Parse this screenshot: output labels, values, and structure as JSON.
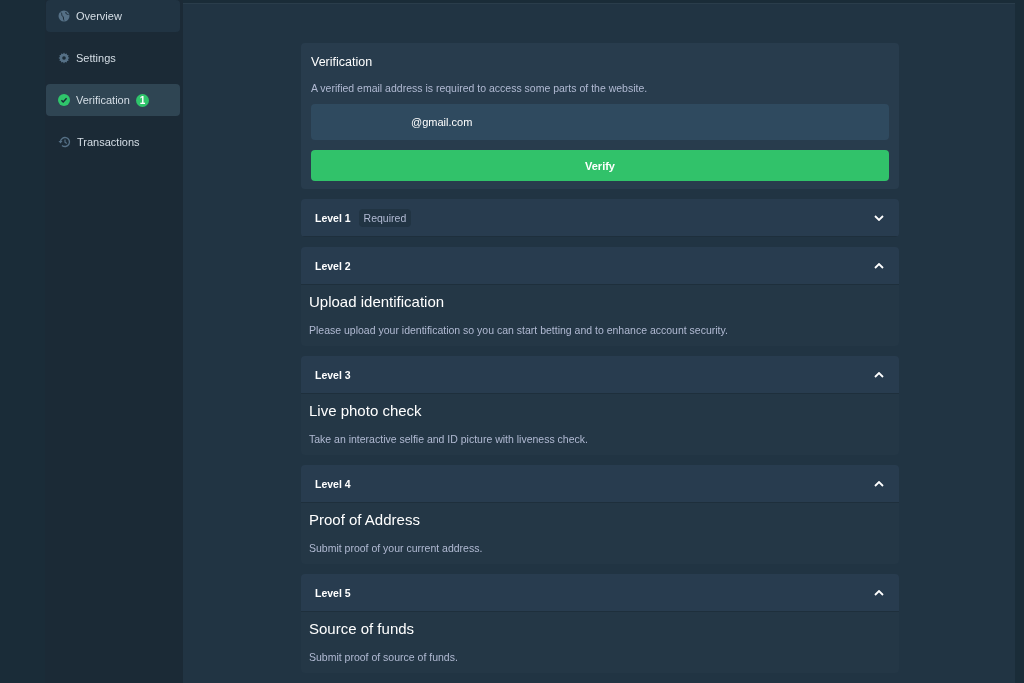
{
  "sidebar": {
    "items": [
      {
        "label": "Overview",
        "kind": "globe",
        "selected": false,
        "hovered": true
      },
      {
        "label": "Settings",
        "kind": "gear",
        "selected": false,
        "hovered": false
      },
      {
        "label": "Verification",
        "kind": "check",
        "selected": true,
        "hovered": false,
        "badge": "1"
      },
      {
        "label": "Transactions",
        "kind": "history",
        "selected": false,
        "hovered": false
      }
    ]
  },
  "verification": {
    "title": "Verification",
    "description": "A verified email address is required to access some parts of the website.",
    "email": "@gmail.com",
    "button": "Verify"
  },
  "levels": [
    {
      "title": "Level 1",
      "tag": "Required",
      "expanded": false
    },
    {
      "title": "Level 2",
      "expanded": true,
      "heading": "Upload identification",
      "text": "Please upload your identification so you can start betting and to enhance account security."
    },
    {
      "title": "Level 3",
      "expanded": true,
      "heading": "Live photo check",
      "text": "Take an interactive selfie and ID picture with liveness check."
    },
    {
      "title": "Level 4",
      "expanded": true,
      "heading": "Proof of Address",
      "text": "Submit proof of your current address."
    },
    {
      "title": "Level 5",
      "expanded": true,
      "heading": "Source of funds",
      "text": "Submit proof of source of funds."
    }
  ]
}
